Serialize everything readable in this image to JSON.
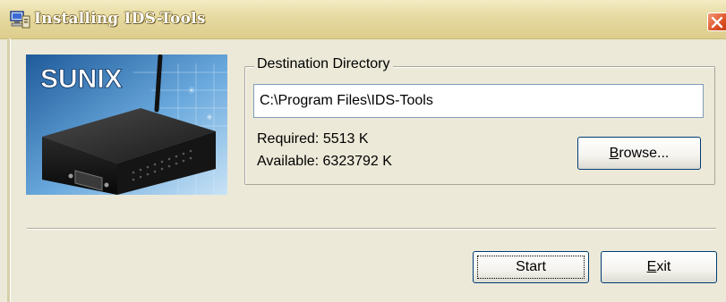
{
  "window": {
    "title": "Installing IDS-Tools"
  },
  "branding": {
    "logo_text": "SUNIX"
  },
  "destination": {
    "group_label": "Destination Directory",
    "path_value": "C:\\Program Files\\IDS-Tools",
    "required_text": "Required: 5513 K",
    "available_text": "Available: 6323792 K"
  },
  "buttons": {
    "browse_mnemonic": "B",
    "browse_rest": "rowse...",
    "start_label": "Start",
    "exit_mnemonic": "E",
    "exit_rest": "xit"
  },
  "icons": {
    "title": "installer-computer-icon",
    "close": "close-x-icon"
  },
  "colors": {
    "titlebar": "#e6d9a0",
    "close_button": "#e05a2e",
    "dialog_bg": "#ece9d8",
    "input_border": "#7f9db9",
    "button_border": "#003c74"
  }
}
